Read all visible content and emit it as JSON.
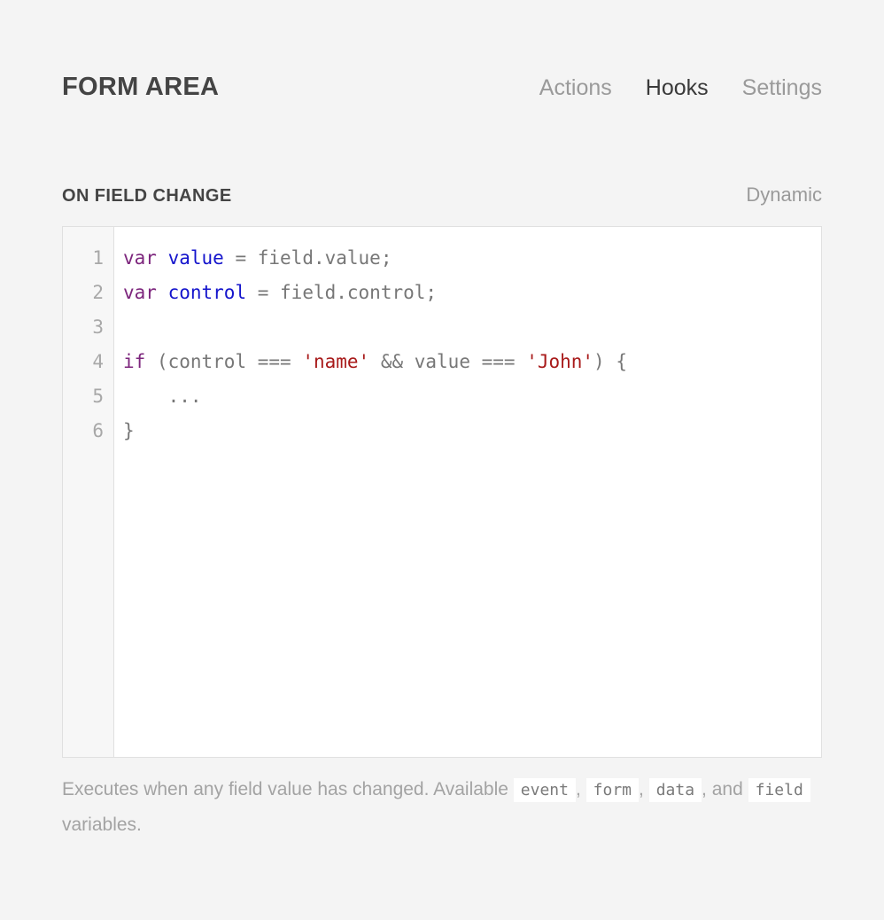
{
  "header": {
    "title": "FORM AREA",
    "tabs": [
      {
        "label": "Actions",
        "active": false
      },
      {
        "label": "Hooks",
        "active": true
      },
      {
        "label": "Settings",
        "active": false
      }
    ]
  },
  "section": {
    "title": "ON FIELD CHANGE",
    "mode": "Dynamic"
  },
  "editor": {
    "line_numbers": [
      "1",
      "2",
      "3",
      "4",
      "5",
      "6"
    ],
    "lines": [
      {
        "number": "1",
        "text": "var value = field.value;",
        "tokens": [
          {
            "t": "var",
            "c": "kw"
          },
          {
            "t": " ",
            "c": "pln"
          },
          {
            "t": "value",
            "c": "var"
          },
          {
            "t": " = field.value;",
            "c": "pln"
          }
        ]
      },
      {
        "number": "2",
        "text": "var control = field.control;",
        "tokens": [
          {
            "t": "var",
            "c": "kw"
          },
          {
            "t": " ",
            "c": "pln"
          },
          {
            "t": "control",
            "c": "var"
          },
          {
            "t": " = field.control;",
            "c": "pln"
          }
        ]
      },
      {
        "number": "3",
        "text": "",
        "tokens": []
      },
      {
        "number": "4",
        "text": "if (control === 'name' && value === 'John') {",
        "tokens": [
          {
            "t": "if",
            "c": "kw"
          },
          {
            "t": " (control === ",
            "c": "pln"
          },
          {
            "t": "'name'",
            "c": "str"
          },
          {
            "t": " && value === ",
            "c": "pln"
          },
          {
            "t": "'John'",
            "c": "str"
          },
          {
            "t": ") {",
            "c": "pln"
          }
        ]
      },
      {
        "number": "5",
        "text": "    ...",
        "tokens": [
          {
            "t": "    ...",
            "c": "pln"
          }
        ]
      },
      {
        "number": "6",
        "text": "}",
        "tokens": [
          {
            "t": "}",
            "c": "pln"
          }
        ]
      }
    ]
  },
  "help": {
    "lead": "Executes when any field value has changed. Available ",
    "chip_event": "event",
    "sep1": ", ",
    "chip_form": "form",
    "sep2": ", ",
    "chip_data": "data",
    "sep3": ", and ",
    "chip_field": "field",
    "tail": " variables."
  },
  "colors": {
    "page_background": "#f4f4f4",
    "editor_background": "#ffffff",
    "editor_border": "#e0e0e0",
    "gutter_background": "#f7f7f7",
    "title": "#444444",
    "tab_inactive": "#9a9a9a",
    "tab_active": "#3a3a3a",
    "code_plain": "#777777",
    "code_keyword": "#7d267d",
    "code_variable": "#1414cc",
    "code_string": "#a81a1a",
    "help_text": "#a3a3a3"
  }
}
